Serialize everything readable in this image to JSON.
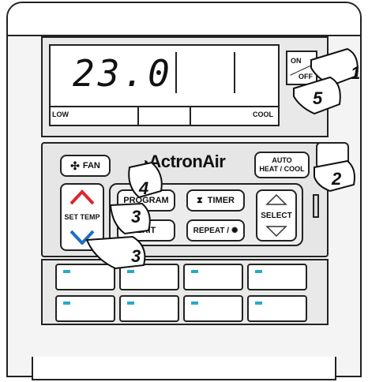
{
  "display": {
    "temperature": "23.0",
    "mode_low": "LOW",
    "mode_cool": "COOL"
  },
  "power": {
    "on_label": "ON",
    "off_label": "OFF"
  },
  "brand": {
    "name": "ActronAir"
  },
  "buttons": {
    "fan": "FAN",
    "auto_line1": "AUTO",
    "auto_line2": "HEAT / COOL",
    "set_temp": "SET TEMP",
    "program": "PROGRAM",
    "timer": "TIMER",
    "exit": "EXIT",
    "repeat": "REPEAT /",
    "select": "SELECT"
  },
  "callouts": [
    "1",
    "5",
    "2",
    "4",
    "3",
    "3"
  ],
  "zones": {
    "count": 8,
    "led_color": "#2aa9c9"
  },
  "colors": {
    "up_arrow": "#e0242b",
    "down_arrow": "#1b6fc4"
  }
}
